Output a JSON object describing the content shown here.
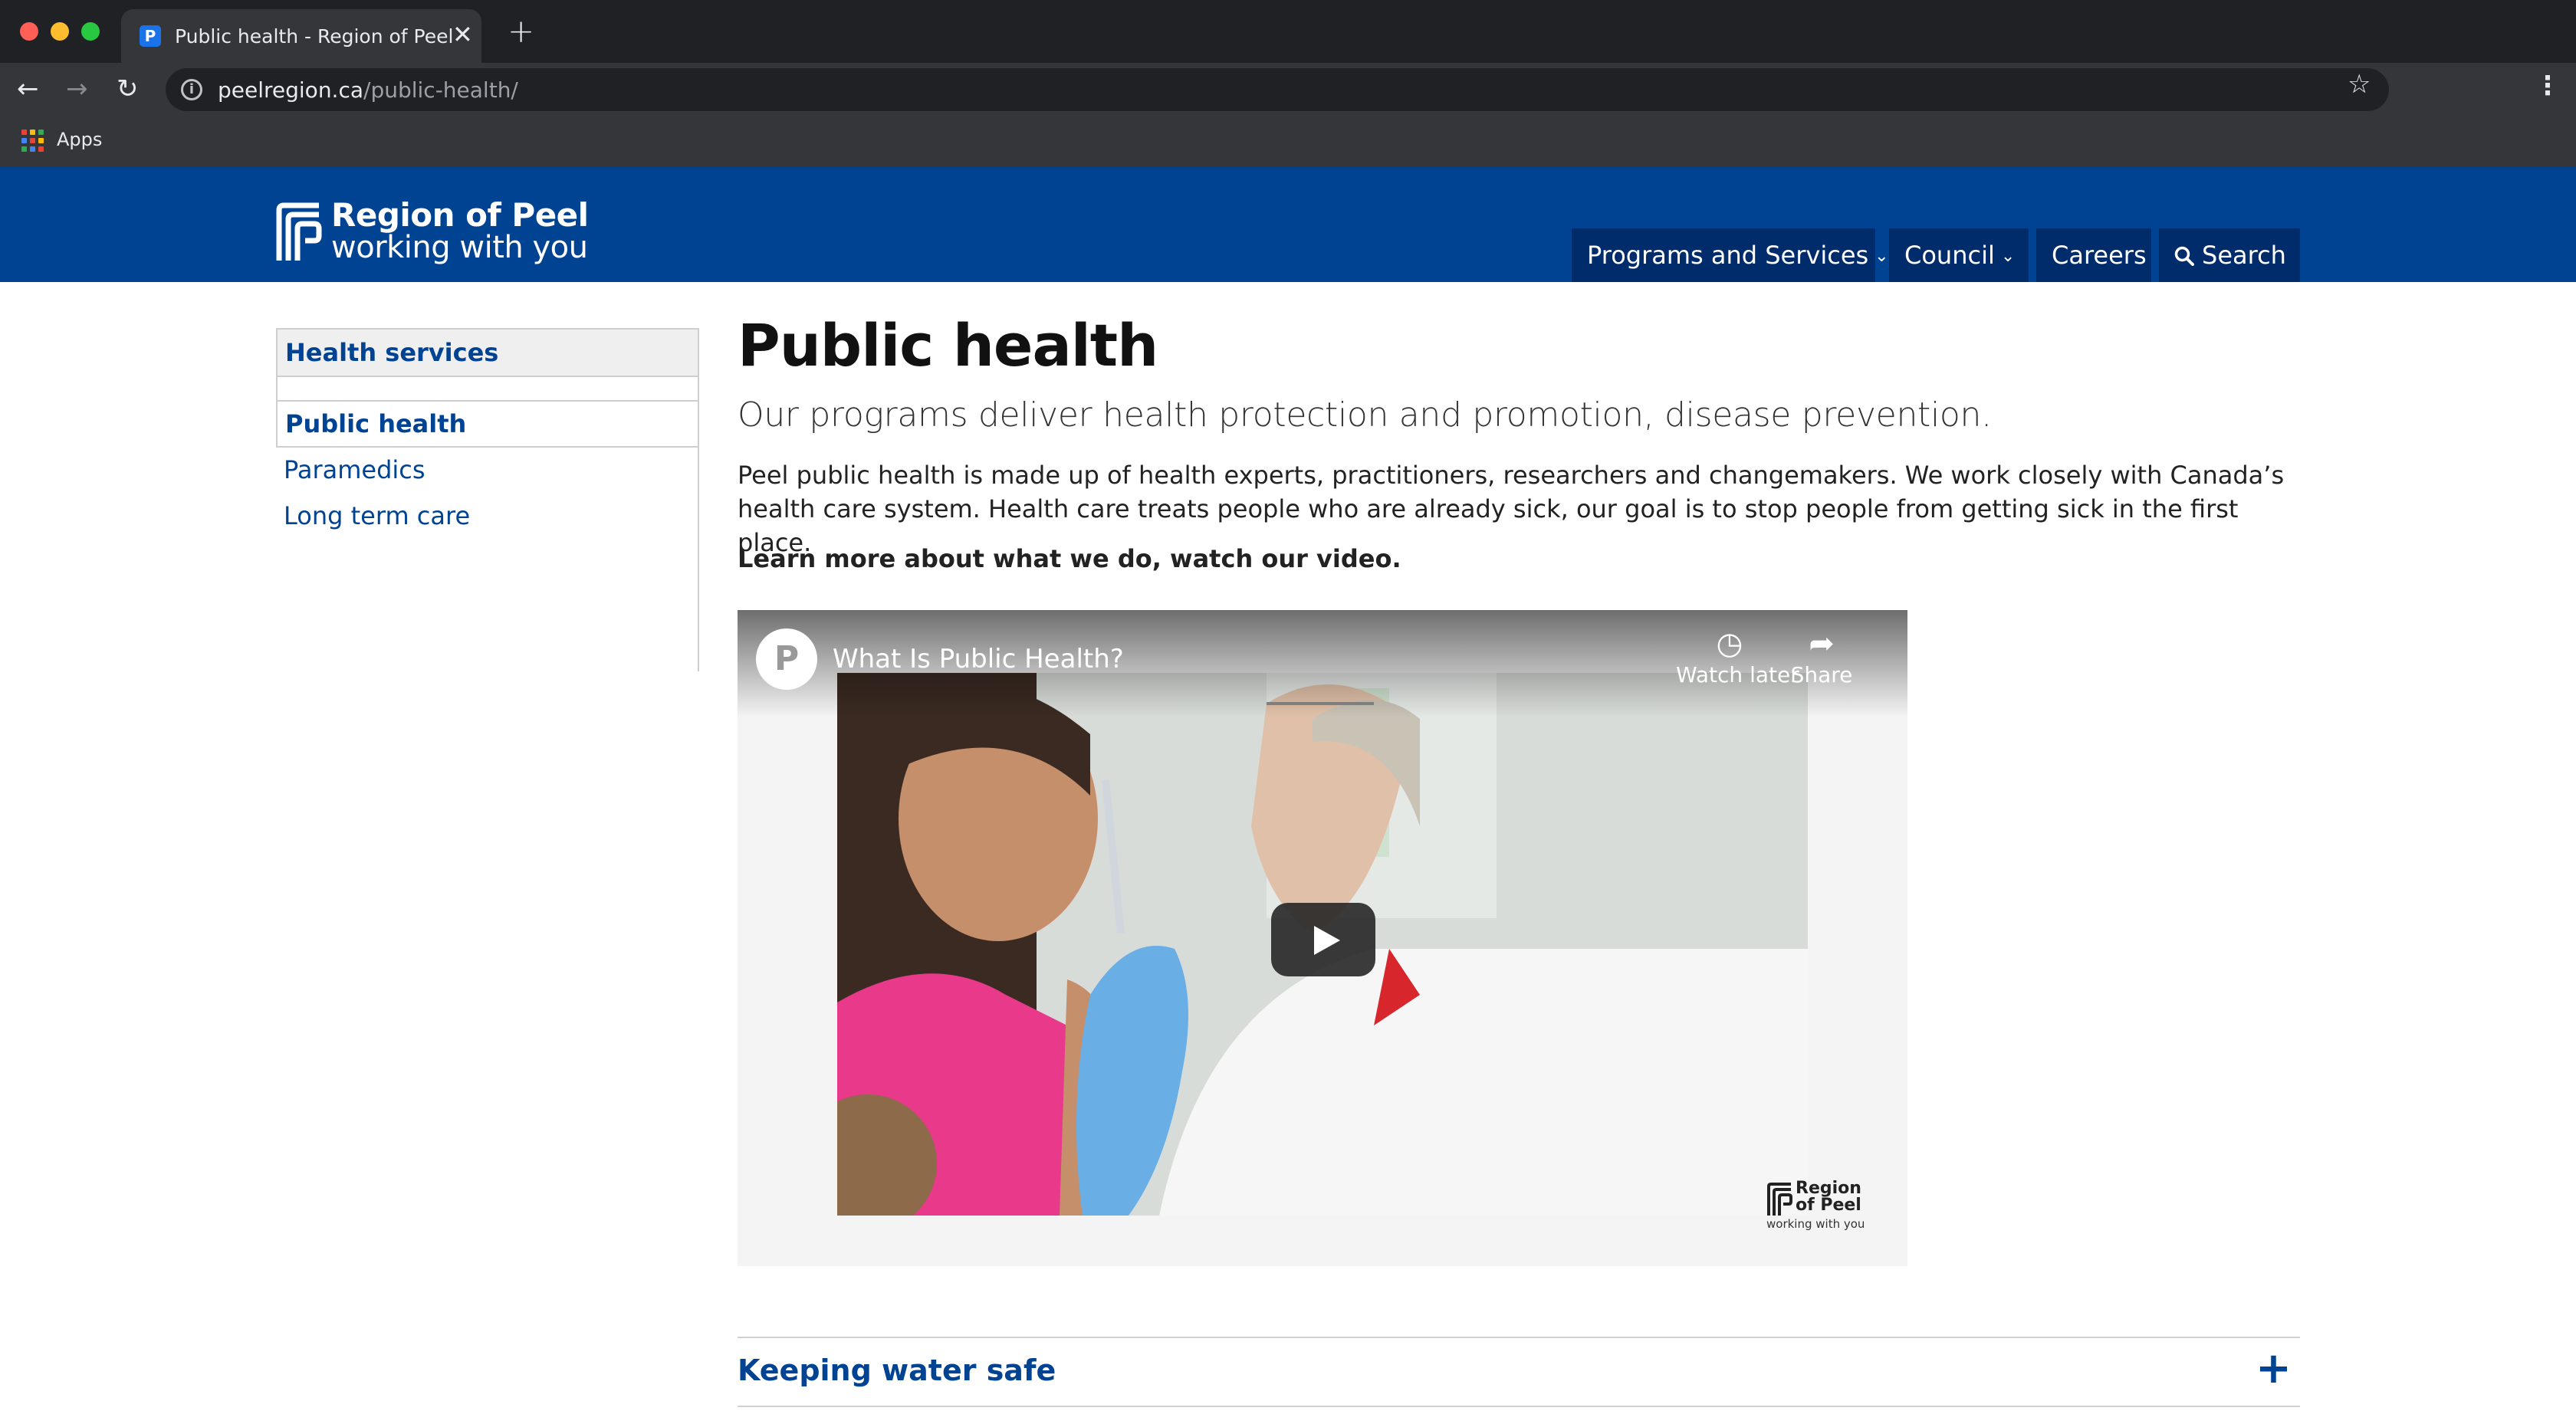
{
  "browser": {
    "tab_title": "Public health - Region of Peel",
    "tab_close": "✕",
    "new_tab": "+",
    "url_domain": "peelregion.ca",
    "url_path": "/public-health/",
    "bookmarks_apps": "Apps",
    "icons": [
      "back-icon",
      "forward-icon",
      "reload-icon",
      "info-icon",
      "star-icon",
      "menu-icon",
      "apps-icon"
    ]
  },
  "site": {
    "logo_line1": "Region of Peel",
    "logo_line2": "working with you",
    "nav": {
      "programs": "Programs and Services",
      "council": "Council",
      "careers": "Careers",
      "search": "Search"
    },
    "colors": {
      "brand_blue": "#004393",
      "nav_dark": "#002c6b"
    }
  },
  "sidebar": {
    "heading": "Health services",
    "items": [
      {
        "label": "Public health",
        "active": true
      },
      {
        "label": "Paramedics",
        "active": false
      },
      {
        "label": "Long term care",
        "active": false
      }
    ]
  },
  "main": {
    "title": "Public health",
    "lead": "Our programs deliver health protection and promotion, disease prevention.",
    "body": "Peel public health is made up of health experts, practitioners, researchers and changemakers. We work closely with Canada’s health care system. Health care treats people who are already sick, our goal is to stop people from getting sick in the first place.",
    "cta": "Learn more about what we do, watch our video."
  },
  "video": {
    "title": "What Is Public Health?",
    "watch_later": "Watch later",
    "share": "Share",
    "watermark_line1": "Region",
    "watermark_line2": "of Peel",
    "watermark_line3": "working with you"
  },
  "accordion": {
    "title": "Keeping water safe",
    "toggle": "+"
  }
}
